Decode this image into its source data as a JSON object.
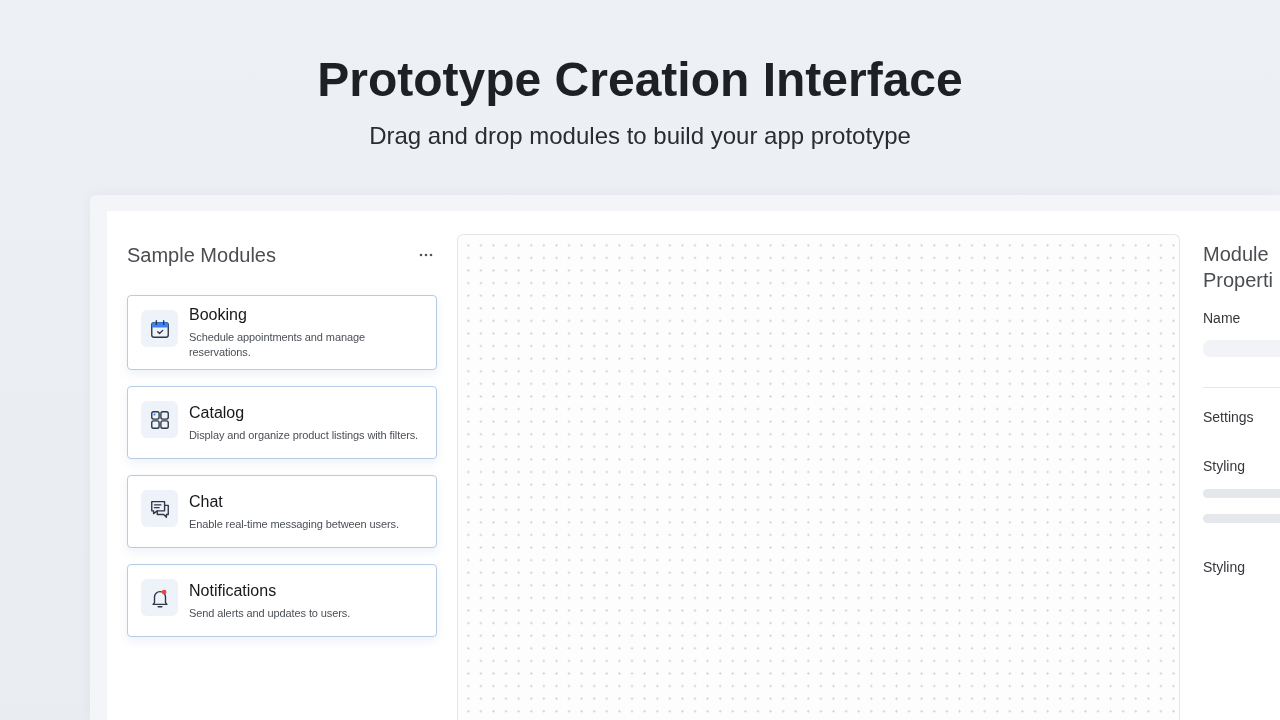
{
  "header": {
    "title": "Prototype Creation Interface",
    "subtitle": "Drag and drop modules to build your app prototype"
  },
  "modules_panel": {
    "title": "Sample Modules",
    "modules": [
      {
        "kind": "scheduling",
        "title": "Booking",
        "description": "Schedule appointments and manage reservations."
      },
      {
        "kind": "listing",
        "title": "Catalog",
        "description": "Display and organize product listings with filters."
      },
      {
        "kind": "messaging",
        "title": "Chat",
        "description": "Enable real-time messaging between users."
      },
      {
        "kind": "alerts",
        "title": "Notifications",
        "description": "Send alerts and updates to users."
      }
    ]
  },
  "properties_panel": {
    "title": "Module Properti",
    "items": [
      {
        "kind": "field",
        "label": "Name"
      },
      {
        "kind": "section",
        "label": "Settings"
      },
      {
        "kind": "group",
        "label": "Styling"
      },
      {
        "kind": "section",
        "label": "Styling"
      }
    ]
  }
}
